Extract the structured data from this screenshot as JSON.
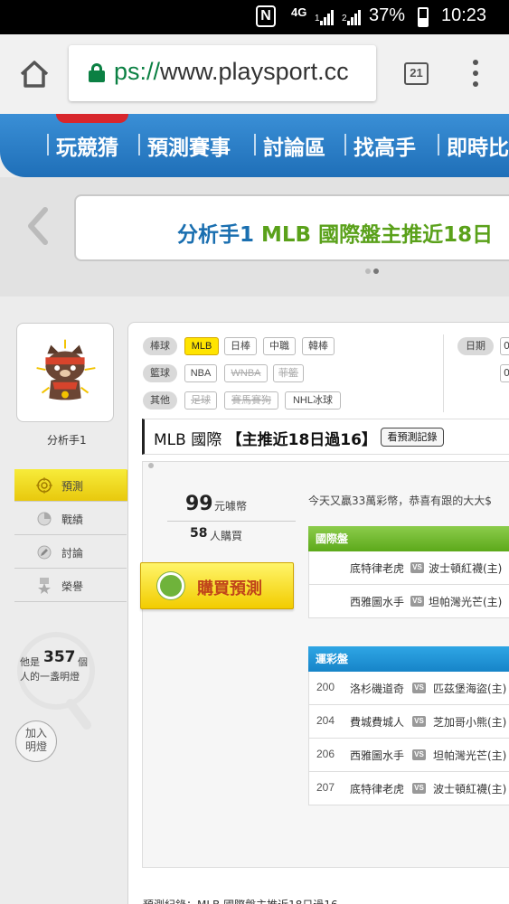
{
  "status_bar": {
    "battery": "37%",
    "time": "10:23",
    "nfc": "N",
    "net": "4G",
    "sim1": "1",
    "sim2": "2"
  },
  "browser": {
    "url_scheme": "ps://",
    "url_host": "www.playsport.cc",
    "tab_count": "21"
  },
  "site_nav": {
    "items": [
      "玩競猜",
      "預測賽事",
      "討論區",
      "找高手",
      "即時比"
    ]
  },
  "banner": {
    "text_prefix": "分析手1 ",
    "text_green": "MLB 國際盤主推近18日"
  },
  "sidebar": {
    "name": "分析手1",
    "items": [
      "預測",
      "戰績",
      "討論",
      "榮譽"
    ],
    "lamp_pre": "他是",
    "lamp_count": "357",
    "lamp_post": "個",
    "lamp_desc": "人的一盞明燈",
    "join_label_1": "加入",
    "join_label_2": "明燈"
  },
  "filters": {
    "rows": [
      {
        "category": "棒球",
        "tags": [
          "MLB",
          "日棒",
          "中職",
          "韓棒"
        ]
      },
      {
        "category": "籃球",
        "tags": [
          "NBA",
          "WNBA",
          "菲籃"
        ]
      },
      {
        "category": "其他",
        "tags": [
          "足球",
          "賽馬賽狗",
          "NHL冰球"
        ]
      }
    ],
    "date_label": "日期",
    "date_value_1": "0",
    "date_value_2": "0",
    "selected": "MLB"
  },
  "title": {
    "league": "MLB 國際 ",
    "headline": "【主推近18日過16】",
    "record_button": "看預測記錄"
  },
  "purchase": {
    "price": "99",
    "price_unit": "元噱幣",
    "buyers": "58",
    "buyers_unit": "人購買",
    "buy_label": "購買預測"
  },
  "marquee": "今天又贏33萬彩幣，恭喜有跟的大大$",
  "intl": {
    "header": "國際盤",
    "games": [
      {
        "away": "底特律老虎",
        "home": "波士頓紅襪(主)"
      },
      {
        "away": "西雅圖水手",
        "home": "坦帕灣光芒(主)"
      }
    ]
  },
  "lottery": {
    "header": "運彩盤",
    "games": [
      {
        "num": "200",
        "away": "洛杉磯道奇",
        "home": "匹茲堡海盜(主)"
      },
      {
        "num": "204",
        "away": "費城費城人",
        "home": "芝加哥小熊(主)"
      },
      {
        "num": "206",
        "away": "西雅圖水手",
        "home": "坦帕灣光芒(主)"
      },
      {
        "num": "207",
        "away": "底特律老虎",
        "home": "波士頓紅襪(主)"
      }
    ]
  },
  "vs_label": "VS",
  "footer": "預測紀錄：MLB 國際盤主推近18日過16",
  "colors": {
    "nav_blue": "#2a7cc7",
    "accent_yellow": "#ffe400",
    "banner_blue": "#1a6fb0",
    "banner_green": "#5aa11a",
    "green_header": "#5ca91a",
    "blue_header": "#1684c8"
  }
}
